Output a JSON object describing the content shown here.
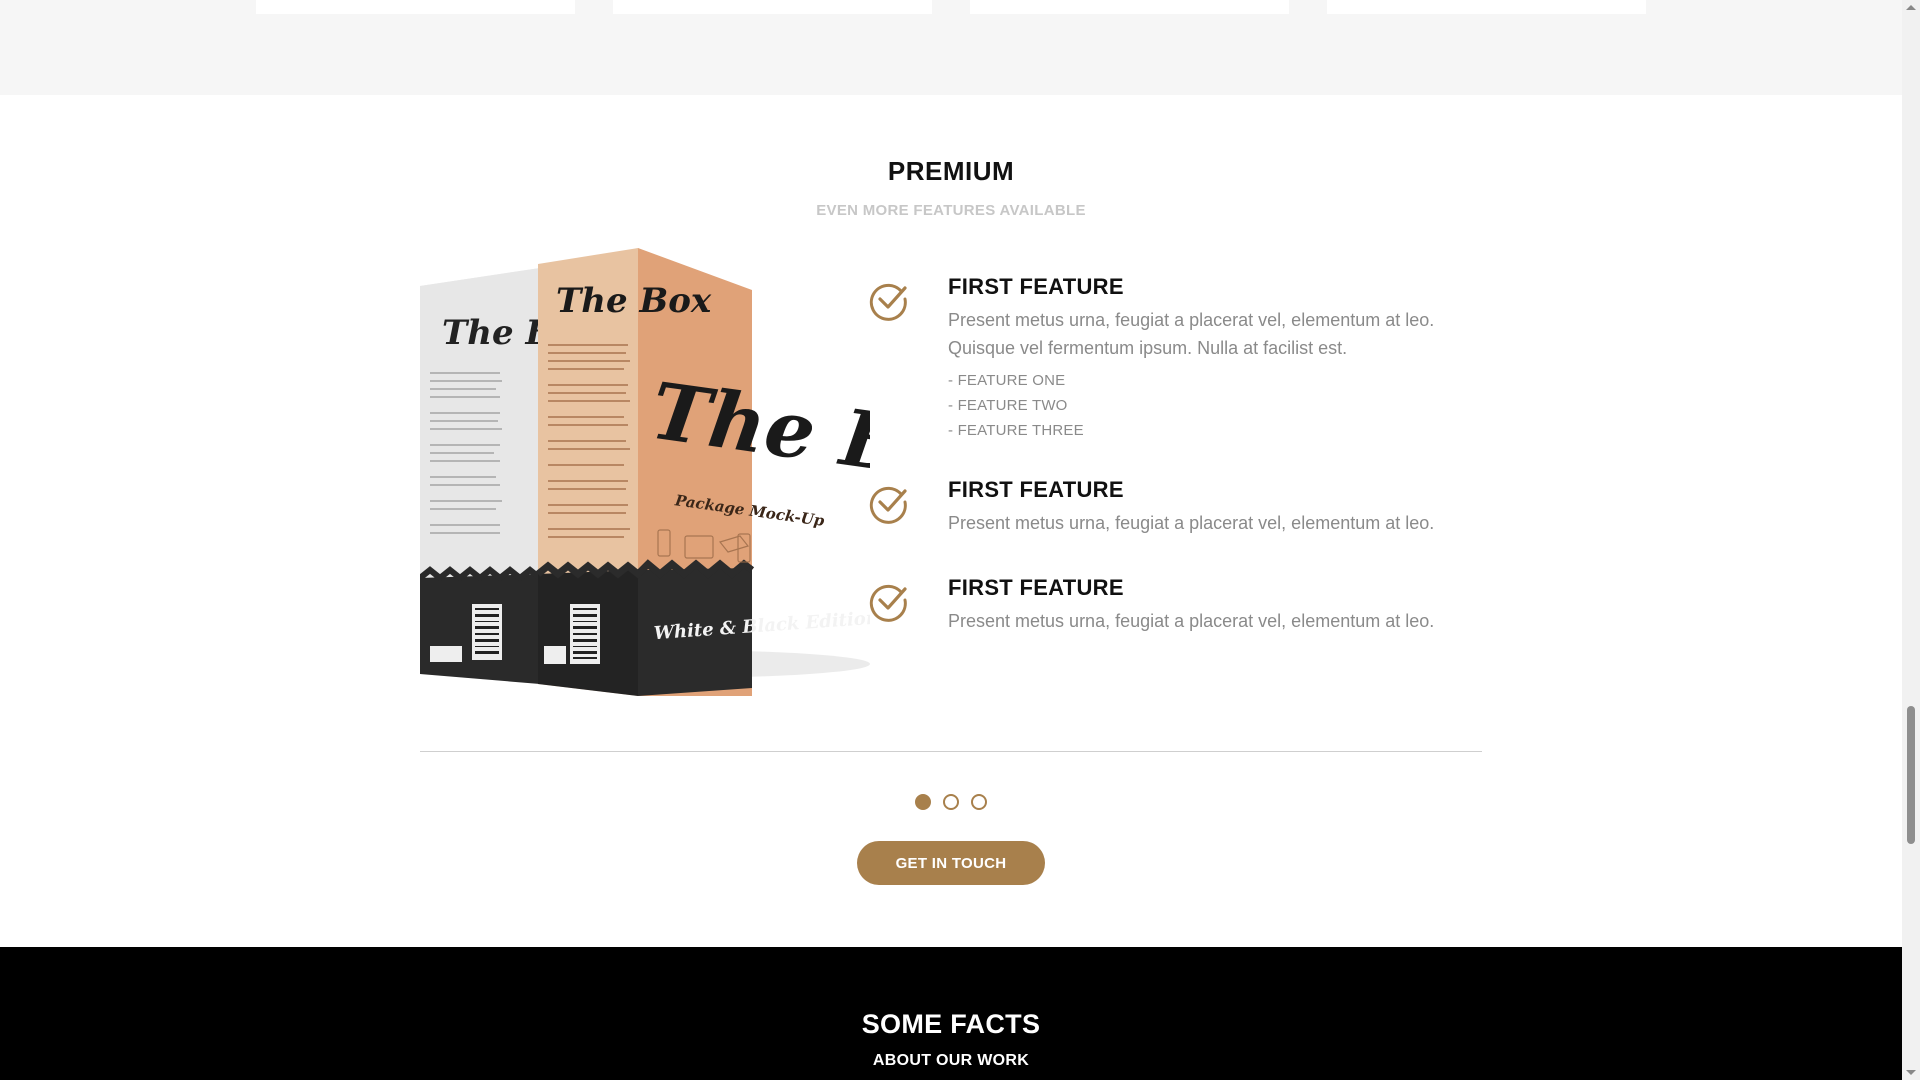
{
  "premium": {
    "title": "PREMIUM",
    "subtitle": "EVEN MORE FEATURES AVAILABLE"
  },
  "product": {
    "front_box_text": "The Box",
    "front_box_caption": "Package Mock-Up",
    "front_box_edition": "White & Black Edition",
    "back_box_text": "The Box"
  },
  "features": [
    {
      "title": "FIRST FEATURE",
      "description": "Present metus urna, feugiat a placerat vel, elementum at leo. Quisque vel fermentum ipsum. Nulla at facilist est.",
      "bullets": [
        "- FEATURE ONE",
        "- FEATURE TWO",
        "- FEATURE THREE"
      ]
    },
    {
      "title": "FIRST FEATURE",
      "description": "Present metus urna, feugiat a placerat vel, elementum at leo."
    },
    {
      "title": "FIRST FEATURE",
      "description": "Present metus urna, feugiat a placerat vel, elementum at leo."
    }
  ],
  "carousel": {
    "slides": 3,
    "active_index": 0
  },
  "cta": {
    "label": "GET IN TOUCH"
  },
  "facts": {
    "title": "SOME FACTS",
    "subtitle": "ABOUT OUR WORK"
  },
  "colors": {
    "accent": "#a8804c",
    "box_front": "#e0a278",
    "dark_section": "#000000"
  },
  "icons": {
    "feature": "check-circle-icon"
  }
}
